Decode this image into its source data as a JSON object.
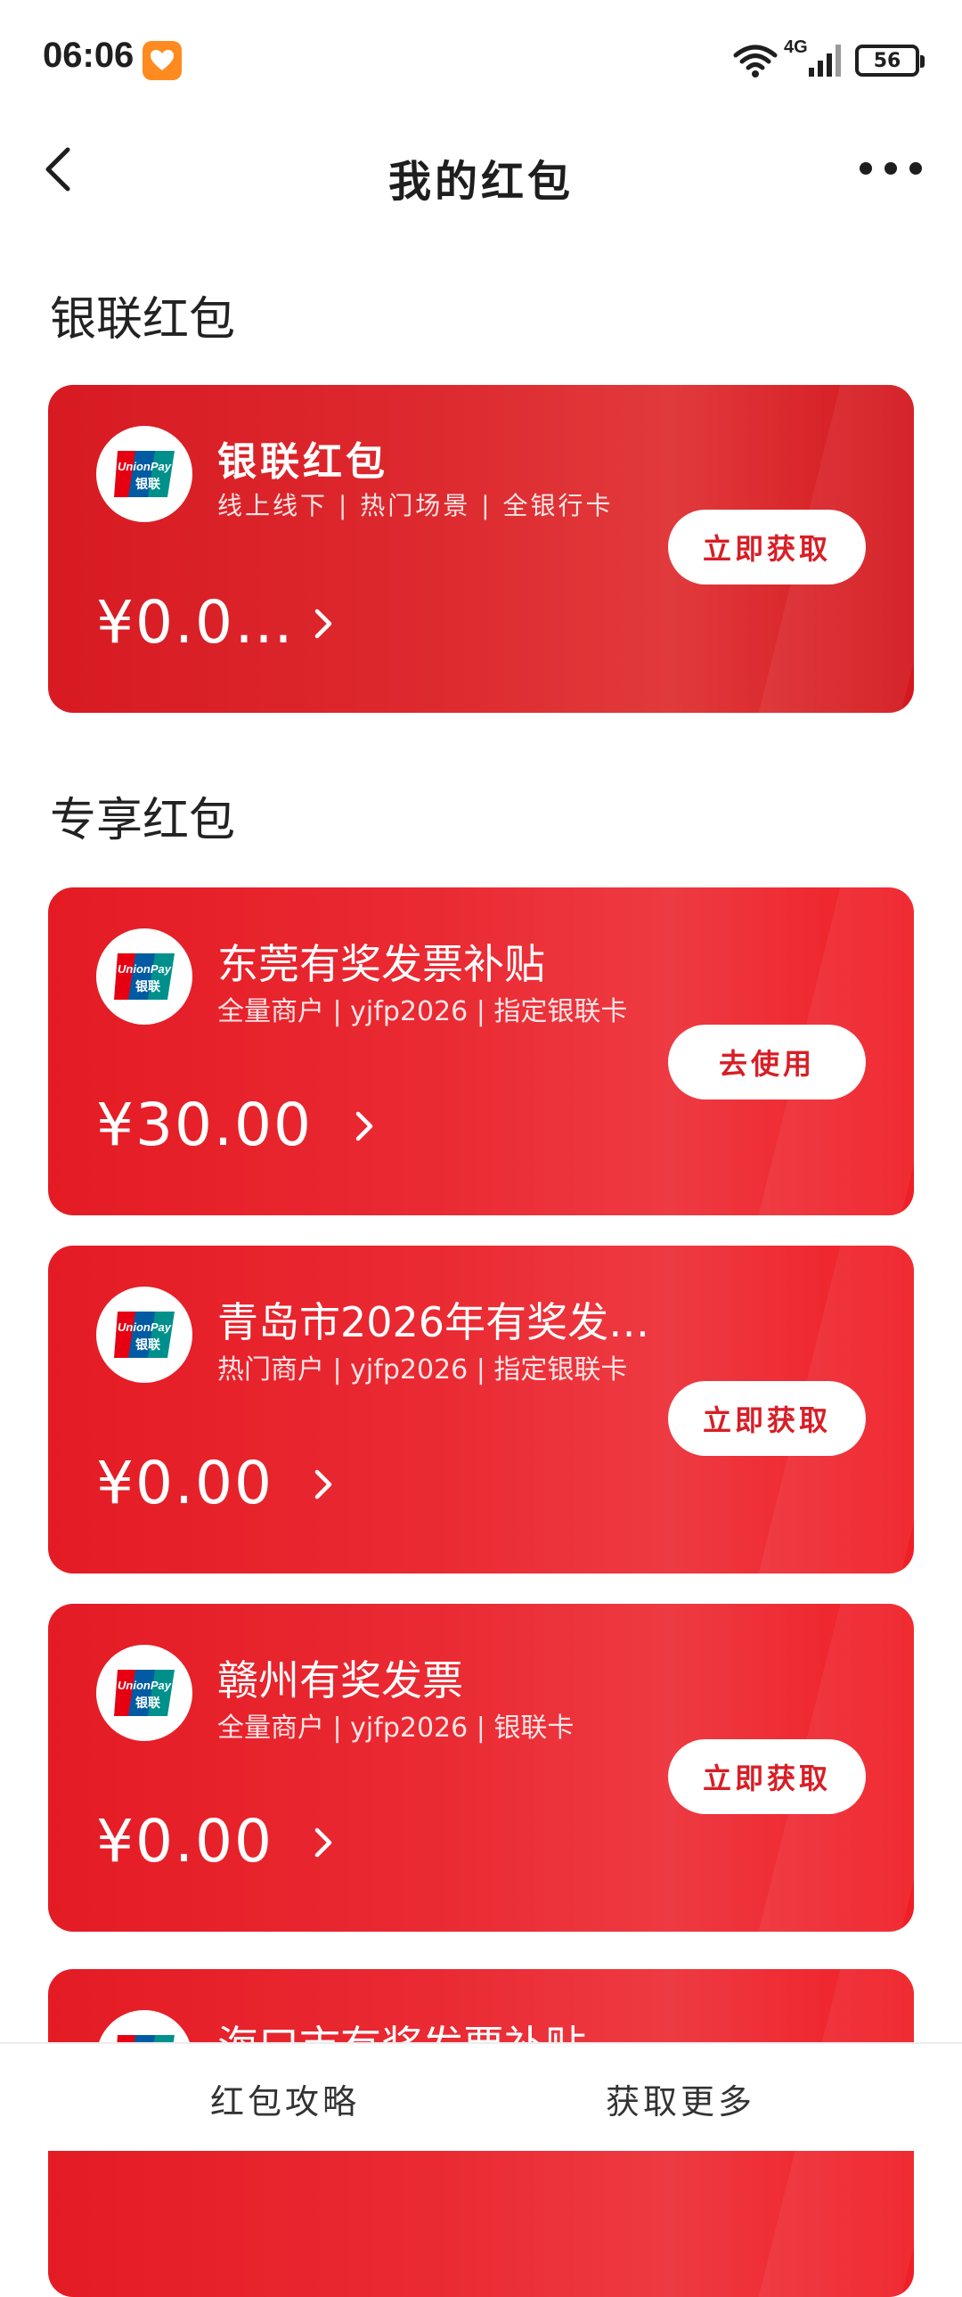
{
  "status_bar": {
    "time": "06:06",
    "network": "4G",
    "battery": "56"
  },
  "header": {
    "title": "我的红包"
  },
  "sections": {
    "unionpay_title": "银联红包",
    "exclusive_title": "专享红包"
  },
  "unionpay_card": {
    "name": "银联红包",
    "desc": "线上线下 | 热门场景 | 全银行卡",
    "amount": "¥0.0…",
    "action": "立即获取"
  },
  "exclusive_cards": [
    {
      "name": "东莞有奖发票补贴",
      "desc": "全量商户 | yjfp2026 | 指定银联卡",
      "amount": "¥30.00",
      "action": "去使用"
    },
    {
      "name": "青岛市2026年有奖发…",
      "desc": "热门商户 | yjfp2026 | 指定银联卡",
      "amount": "¥0.00",
      "action": "立即获取"
    },
    {
      "name": "赣州有奖发票",
      "desc": "全量商户 | yjfp2026 | 银联卡",
      "amount": "¥0.00",
      "action": "立即获取"
    },
    {
      "name": "海口市有奖发票补贴",
      "desc": "",
      "amount": "",
      "action": ""
    }
  ],
  "logo_text": {
    "line1": "UnionPay",
    "line2": "银联"
  },
  "bottom_bar": {
    "left_label": "红包攻略",
    "right_label": "获取更多"
  },
  "colors": {
    "card_red": "#e41b24",
    "button_text_red": "#d81e26",
    "unionpay_red": "#e60012",
    "unionpay_blue": "#005ba2",
    "unionpay_green": "#00908c"
  }
}
